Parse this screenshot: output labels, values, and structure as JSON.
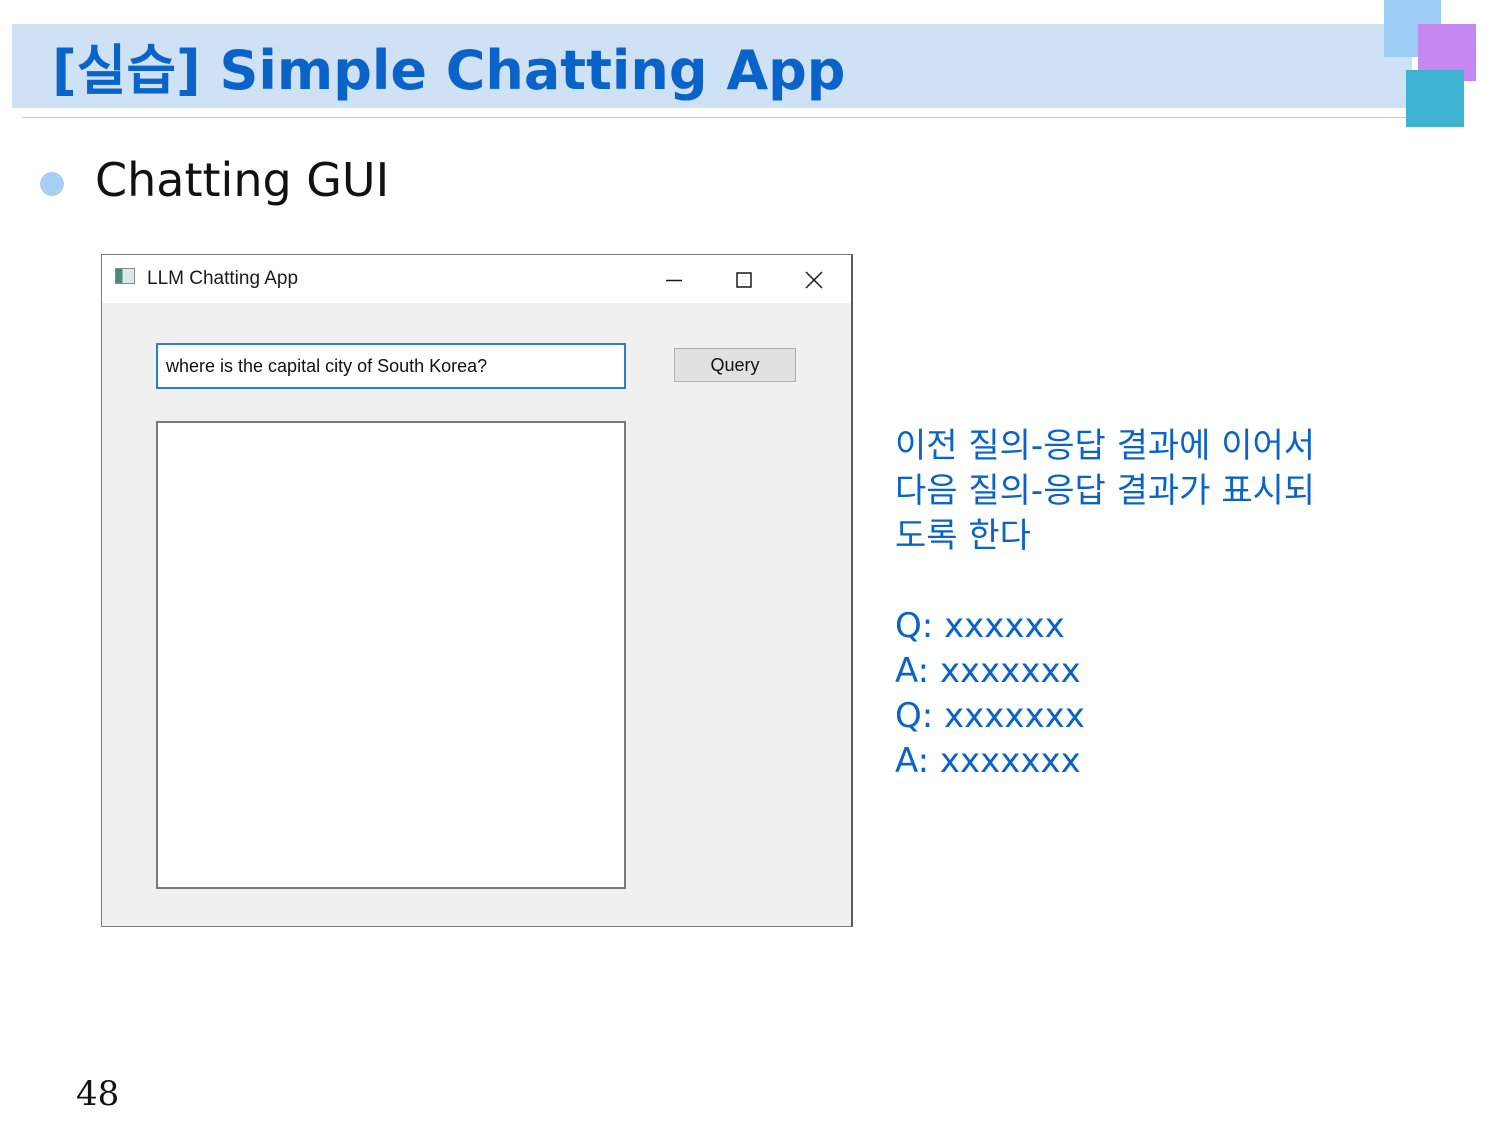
{
  "slide": {
    "title": "[실습] Simple Chatting App",
    "bullet": "Chatting GUI",
    "page_number": "48"
  },
  "window": {
    "title": "LLM Chatting App",
    "controls": {
      "minimize_icon": "minimize-icon",
      "maximize_icon": "maximize-icon",
      "close_icon": "close-icon"
    },
    "query_input": {
      "value": "where is the capital city of South Korea?"
    },
    "query_button_label": "Query",
    "response_area_text": ""
  },
  "note": {
    "lines": [
      "이전 질의-응답 결과에 이어서",
      "다음 질의-응답 결과가 표시되",
      "도록 한다"
    ],
    "examples": [
      "Q: xxxxxx",
      "A: xxxxxxx",
      "Q: xxxxxxx",
      "A: xxxxxxx"
    ]
  },
  "colors": {
    "title_text": "#0a63c9",
    "title_band": "#cfe2f5",
    "deco_blue": "#9dccf5",
    "deco_purple": "#c488f0",
    "deco_teal": "#3fb3d2",
    "bullet_dot": "#a7cff3",
    "input_focus_border": "#2f7bd0"
  }
}
